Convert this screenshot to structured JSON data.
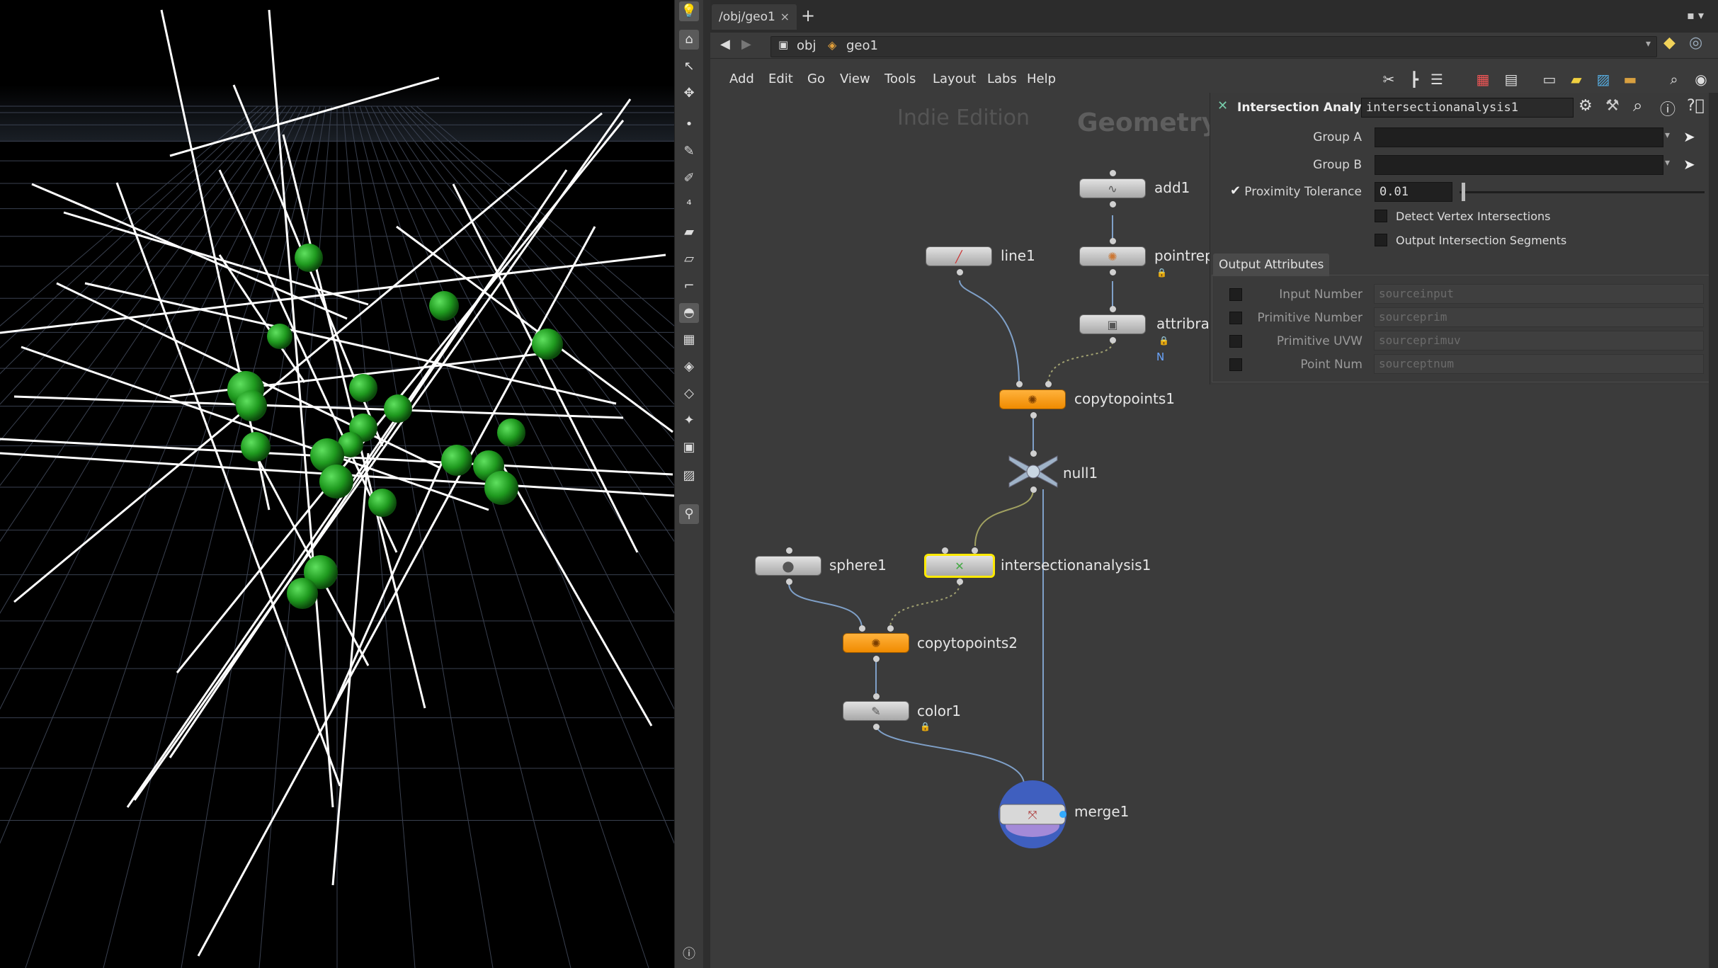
{
  "tab": {
    "label": "/obj/geo1",
    "close": "×",
    "add": "+"
  },
  "pathbar": {
    "back": "◀",
    "forward": "▶",
    "crumb1": "obj",
    "crumb2": "geo1"
  },
  "menu": {
    "items": [
      "Add",
      "Edit",
      "Go",
      "View",
      "Tools",
      "Layout",
      "Labs",
      "Help"
    ]
  },
  "watermark": {
    "edition": "Indie Edition",
    "context": "Geometry"
  },
  "nodes": {
    "add1": "add1",
    "line1": "line1",
    "pointrep": "pointrep",
    "attribrar": "attribrar",
    "copytopoints1": "copytopoints1",
    "null1": "null1",
    "sphere1": "sphere1",
    "intersectionanalysis1": "intersectionanalysis1",
    "copytopoints2": "copytopoints2",
    "color1": "color1",
    "merge1": "merge1",
    "attr_flag": "N"
  },
  "params": {
    "node_type": "Intersection Analysis",
    "node_name": "intersectionanalysis1",
    "group_a_label": "Group A",
    "group_b_label": "Group B",
    "proximity_label": "Proximity Tolerance",
    "proximity_value": "0.01",
    "proximity_slider_fraction": 0.01,
    "detect_vertex_label": "Detect Vertex Intersections",
    "output_segments_label": "Output Intersection Segments",
    "output_tab": "Output Attributes",
    "outputs": [
      {
        "label": "Input Number",
        "value": "sourceinput"
      },
      {
        "label": "Primitive Number",
        "value": "sourceprim"
      },
      {
        "label": "Primitive UVW",
        "value": "sourceprimuv"
      },
      {
        "label": "Point Num",
        "value": "sourceptnum"
      }
    ]
  },
  "icons": {
    "toolbar": [
      "bulb-icon",
      "camera-icon",
      "select-icon",
      "transform-icon",
      "point-icon",
      "brush-icon",
      "sculpt-icon",
      "counter-icon",
      "paint-icon",
      "counter2-icon",
      "snap-icon",
      "curve-icon",
      "view-icon",
      "texture-icon",
      "ghost-icon",
      "mask-icon",
      "pin-icon",
      "display-icon",
      "image-icon",
      "light-pin-icon",
      "info-icon"
    ]
  },
  "colors": {
    "orange_node": "#f5a623",
    "selected_outline": "#ffe900",
    "sphere_green": "#2bb52b",
    "merge_blue": "#3f5fbf"
  }
}
